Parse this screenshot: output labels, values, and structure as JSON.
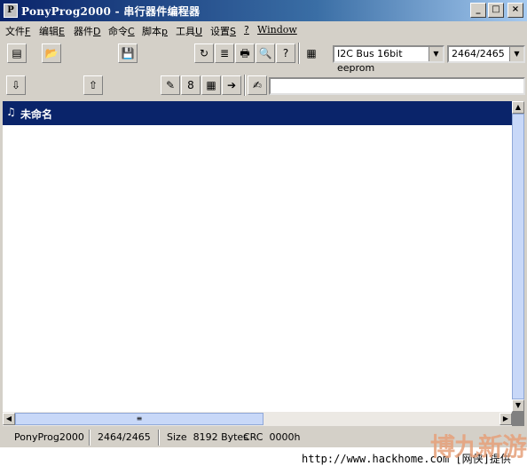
{
  "window": {
    "title": "PonyProg2000 - 串行器件编程器",
    "app_icon": "P",
    "minimize_glyph": "_",
    "maximize_glyph": "□",
    "close_glyph": "×"
  },
  "menu": [
    {
      "label": "文件",
      "key": "F"
    },
    {
      "label": "编辑",
      "key": "E"
    },
    {
      "label": "器件",
      "key": "D"
    },
    {
      "label": "命令",
      "key": "C"
    },
    {
      "label": "脚本",
      "key": "p"
    },
    {
      "label": "工具",
      "key": "U"
    },
    {
      "label": "设置",
      "key": "S"
    },
    {
      "label": "",
      "key": "?"
    },
    {
      "label": "Window",
      "key": ""
    }
  ],
  "toolbar1": {
    "buttons": [
      {
        "icon": "new-icon",
        "glyph": "▤"
      },
      {
        "icon": "open-folder-icon",
        "glyph": "📂"
      },
      {
        "icon": "save-disk-icon",
        "glyph": "💾"
      },
      {
        "icon": "reload-icon",
        "glyph": "↻"
      },
      {
        "icon": "edit-note-icon",
        "glyph": "≣"
      },
      {
        "icon": "print-icon",
        "glyph": "🖶"
      },
      {
        "icon": "find-icon",
        "glyph": "🔍"
      },
      {
        "icon": "help-icon",
        "glyph": "?"
      },
      {
        "icon": "chip-icon",
        "glyph": "▦"
      }
    ],
    "bus_select": "I2C Bus 16bit eeprom",
    "device_select": "2464/2465",
    "dropdown_glyph": "▼"
  },
  "toolbar2": {
    "buttons": [
      {
        "icon": "read-device-icon",
        "glyph": "⇩"
      },
      {
        "icon": "write-device-icon",
        "glyph": "⇧"
      },
      {
        "icon": "erase-icon",
        "glyph": "✎"
      },
      {
        "icon": "security-bits-icon",
        "glyph": "8"
      },
      {
        "icon": "program-grid-icon",
        "glyph": "▦"
      },
      {
        "icon": "next-arrow-icon",
        "glyph": "➔"
      },
      {
        "icon": "script-note-icon",
        "glyph": "✍"
      }
    ],
    "address_value": ""
  },
  "document": {
    "title": "未命名",
    "icon": "document-icon",
    "icon_glyph": "♫"
  },
  "scrollbar": {
    "up": "▲",
    "down": "▼",
    "left": "◀",
    "right": "▶",
    "grip": "≡"
  },
  "status": {
    "app": "PonyProg2000",
    "device": "2464/2465",
    "size": "Size  8192 Bytes",
    "crc": "CRC  0000h"
  },
  "footer": {
    "site": "http://www.hackhome.com [网侠]提供",
    "watermark": "博九新游"
  }
}
